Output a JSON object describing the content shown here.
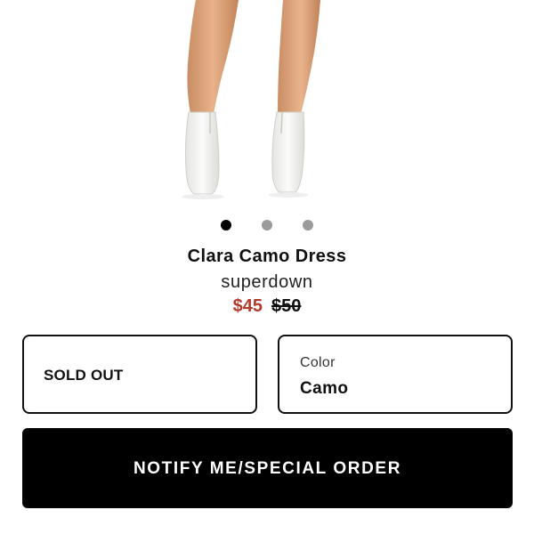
{
  "product": {
    "name": "Clara Camo Dress",
    "brand": "superdown",
    "sale_price": "$45",
    "original_price": "$50"
  },
  "carousel": {
    "dots": 3,
    "active_index": 0
  },
  "options": {
    "size_status": "SOLD OUT",
    "color_label": "Color",
    "color_value": "Camo"
  },
  "actions": {
    "notify_label": "NOTIFY ME/SPECIAL ORDER"
  },
  "colors": {
    "sale_price": "#b23a2b",
    "button_bg": "#000000",
    "dot_active": "#000000",
    "dot_inactive": "#9a9a9a"
  }
}
